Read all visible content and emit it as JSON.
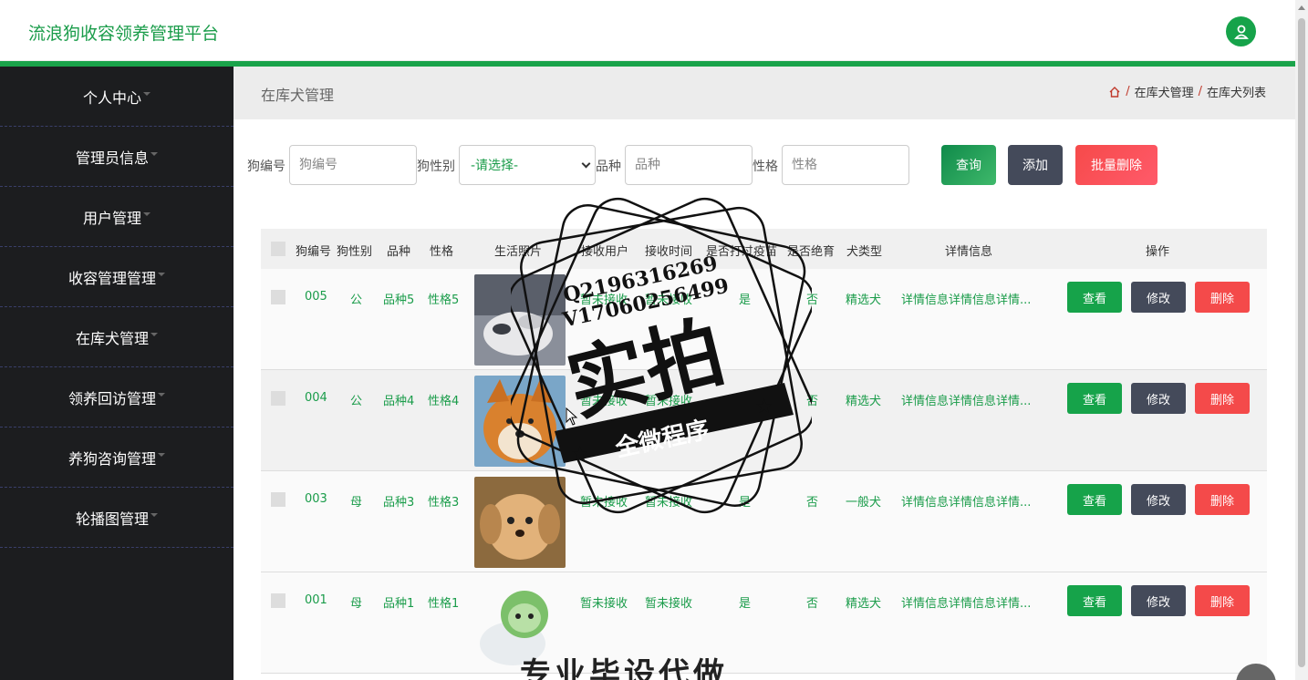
{
  "header": {
    "title": "流浪狗收容领养管理平台"
  },
  "sidebar": {
    "items": [
      {
        "label": "个人中心"
      },
      {
        "label": "管理员信息"
      },
      {
        "label": "用户管理"
      },
      {
        "label": "收容管理管理"
      },
      {
        "label": "在库犬管理"
      },
      {
        "label": "领养回访管理"
      },
      {
        "label": "养狗咨询管理"
      },
      {
        "label": "轮播图管理"
      }
    ]
  },
  "page": {
    "title": "在库犬管理",
    "breadcrumb": [
      "在库犬管理",
      "在库犬列表"
    ]
  },
  "filter": {
    "dog_no_label": "狗编号",
    "dog_no_placeholder": "狗编号",
    "gender_label": "狗性别",
    "gender_value": "-请选择-",
    "breed_label": "品种",
    "breed_placeholder": "品种",
    "temper_label": "性格",
    "temper_placeholder": "性格",
    "search_btn": "查询",
    "add_btn": "添加",
    "batch_delete_btn": "批量删除"
  },
  "table": {
    "headers": [
      "狗编号",
      "狗性别",
      "品种",
      "性格",
      "生活照片",
      "接收用户",
      "接收时间",
      "是否打过疫苗",
      "是否绝育",
      "犬类型",
      "详情信息",
      "操作"
    ],
    "rows": [
      {
        "no": "005",
        "gender": "公",
        "breed": "品种5",
        "temper": "性格5",
        "user": "暂未接收",
        "time": "暂未接收",
        "vaccine": "是",
        "neutered": "否",
        "type": "精选犬",
        "detail": "详情信息详情信息详情..."
      },
      {
        "no": "004",
        "gender": "公",
        "breed": "品种4",
        "temper": "性格4",
        "user": "暂未接收",
        "time": "暂未接收",
        "vaccine": "是",
        "neutered": "否",
        "type": "精选犬",
        "detail": "详情信息详情信息详情..."
      },
      {
        "no": "003",
        "gender": "母",
        "breed": "品种3",
        "temper": "性格3",
        "user": "暂未接收",
        "time": "暂未接收",
        "vaccine": "是",
        "neutered": "否",
        "type": "一般犬",
        "detail": "详情信息详情信息详情..."
      },
      {
        "no": "001",
        "gender": "母",
        "breed": "品种1",
        "temper": "性格1",
        "user": "暂未接收",
        "time": "暂未接收",
        "vaccine": "是",
        "neutered": "否",
        "type": "精选犬",
        "detail": "详情信息详情信息详情..."
      }
    ],
    "actions": {
      "view": "查看",
      "edit": "修改",
      "delete": "删除"
    }
  },
  "watermark": {
    "qq": "Q2196316269",
    "wx": "V17060256499",
    "main": "实拍",
    "sub": "全微程序",
    "bottom": "专业毕设代做"
  },
  "colors": {
    "brand": "#1a9c4a",
    "sidebar": "#1c1d1f",
    "danger": "#f44a4a",
    "dark": "#444a5a"
  }
}
